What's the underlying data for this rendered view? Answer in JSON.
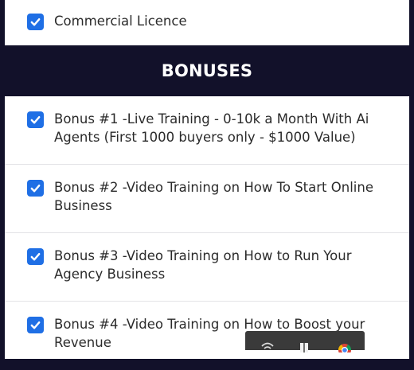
{
  "top_item": {
    "label": "Commercial Licence",
    "checked": true
  },
  "bonuses": {
    "title": "BONUSES",
    "items": [
      {
        "label": "Bonus #1 -Live Training - 0-10k a Month With Ai Agents (First 1000 buyers only - $1000 Value)",
        "checked": true
      },
      {
        "label": "Bonus #2 -Video Training on How To Start Online Business",
        "checked": true
      },
      {
        "label": "Bonus #3 -Video Training on How to Run Your Agency Business",
        "checked": true
      },
      {
        "label": "Bonus #4 -Video Training on How to Boost your Revenue",
        "checked": true
      }
    ]
  },
  "taskbar": {
    "icons": [
      "wifi-icon",
      "shield-icon",
      "chrome-icon"
    ]
  },
  "colors": {
    "background": "#12112a",
    "checkbox": "#1f6fe5",
    "text": "#2b2b2b"
  }
}
